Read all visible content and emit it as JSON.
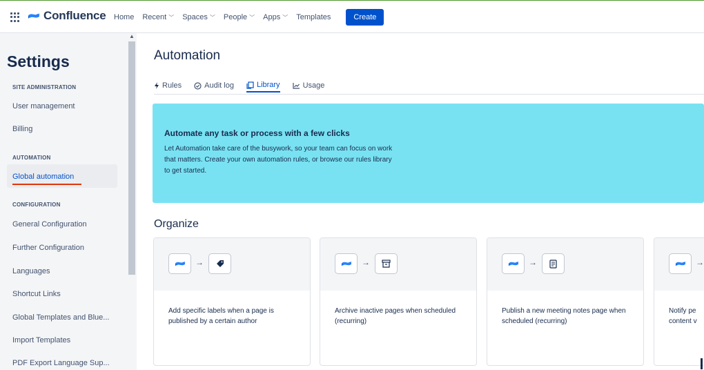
{
  "nav": {
    "logo_text": "Confluence",
    "items": [
      {
        "label": "Home",
        "dropdown": false
      },
      {
        "label": "Recent",
        "dropdown": true
      },
      {
        "label": "Spaces",
        "dropdown": true
      },
      {
        "label": "People",
        "dropdown": true
      },
      {
        "label": "Apps",
        "dropdown": true
      },
      {
        "label": "Templates",
        "dropdown": false
      }
    ],
    "create_label": "Create"
  },
  "sidebar": {
    "title": "Settings",
    "sections": [
      {
        "label": "SITE ADMINISTRATION"
      },
      {
        "label": "AUTOMATION"
      },
      {
        "label": "CONFIGURATION"
      }
    ],
    "items": [
      {
        "label": "User management"
      },
      {
        "label": "Billing"
      },
      {
        "label": "Global automation",
        "active": true
      },
      {
        "label": "General Configuration"
      },
      {
        "label": "Further Configuration"
      },
      {
        "label": "Languages"
      },
      {
        "label": "Shortcut Links"
      },
      {
        "label": "Global Templates and Blue..."
      },
      {
        "label": "Import Templates"
      },
      {
        "label": "PDF Export Language Sup..."
      }
    ]
  },
  "main": {
    "title": "Automation",
    "tabs": [
      {
        "label": "Rules",
        "icon": "lightning-icon"
      },
      {
        "label": "Audit log",
        "icon": "check-circle-icon"
      },
      {
        "label": "Library",
        "icon": "copy-icon",
        "active": true
      },
      {
        "label": "Usage",
        "icon": "line-chart-icon"
      }
    ],
    "banner": {
      "title": "Automate any task or process with a few clicks",
      "text": "Let Automation take care of the busywork, so your team can focus on work that matters. Create your own automation rules, or browse our rules library to get started."
    },
    "section_title": "Organize",
    "cards": [
      {
        "text": "Add specific labels when a page is published by a certain author",
        "icon": "tag-icon"
      },
      {
        "text": "Archive inactive pages when scheduled (recurring)",
        "icon": "archive-icon"
      },
      {
        "text": "Publish a new meeting notes page when scheduled (recurring)",
        "icon": "document-icon"
      },
      {
        "text": "Notify pe content v",
        "icon": ""
      }
    ]
  },
  "colors": {
    "primary": "#0052cc",
    "banner": "#79e2f2",
    "sidebar_bg": "#f4f5f7",
    "highlight_underline": "#de350b"
  }
}
